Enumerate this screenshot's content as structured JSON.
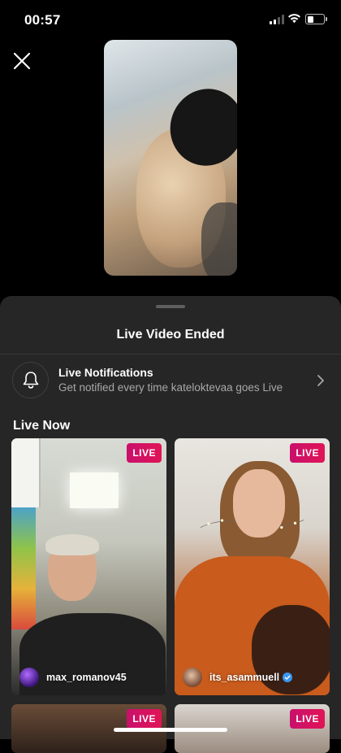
{
  "status_bar": {
    "time": "00:57"
  },
  "sheet": {
    "title": "Live Video Ended",
    "notifications": {
      "title": "Live Notifications",
      "subtitle": "Get notified every time kateloktevaa goes Live"
    },
    "live_now_header": "Live Now"
  },
  "live_streams": [
    {
      "username": "max_romanov45",
      "badge": "LIVE",
      "verified": false
    },
    {
      "username": "its_asammuell",
      "badge": "LIVE",
      "verified": true
    },
    {
      "username": "",
      "badge": "LIVE",
      "verified": false
    },
    {
      "username": "",
      "badge": "LIVE",
      "verified": false
    }
  ],
  "colors": {
    "live_badge": "#d8125f",
    "sheet_background": "#262626",
    "verified_badge": "#3897f0"
  }
}
